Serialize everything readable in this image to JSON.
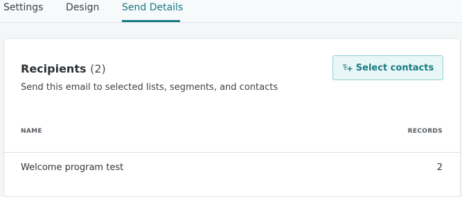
{
  "tabs": [
    {
      "label": "Settings",
      "active": false
    },
    {
      "label": "Design",
      "active": false
    },
    {
      "label": "Send Details",
      "active": true
    }
  ],
  "recipients": {
    "title": "Recipients",
    "count": "(2)",
    "subtitle": "Send this email to selected lists, segments, and contacts",
    "select_button": {
      "label": "Select contacts",
      "icon": "add-list-icon"
    }
  },
  "table": {
    "columns": [
      "NAME",
      "RECORDS"
    ],
    "rows": [
      {
        "name": "Welcome program test",
        "records": "2"
      }
    ]
  },
  "colors": {
    "accent": "#157a80",
    "button_bg": "#e9f6f7",
    "button_border": "#8fd0d4"
  }
}
